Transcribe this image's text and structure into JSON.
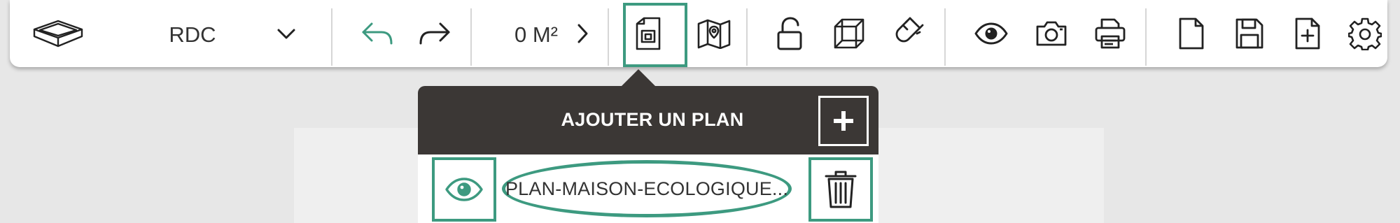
{
  "colors": {
    "accent": "#3d9a80",
    "popup_dark": "#3b3735",
    "toolbar_bg": "#ffffff",
    "workspace_bg": "#e7e7e7"
  },
  "toolbar": {
    "view_3d_icon": "box-3d-icon",
    "level": {
      "label": "RDC",
      "dropdown_icon": "chevron-down-icon"
    },
    "undo_icon": "undo-arrow-icon",
    "redo_icon": "redo-arrow-icon",
    "area": {
      "label": "0 M²",
      "expand_icon": "chevron-right-icon"
    },
    "plan_icon": "plan-document-icon",
    "map_icon": "folded-map-icon",
    "lock_icon": "unlocked-padlock-icon",
    "cube_icon": "wireframe-cube-icon",
    "magnet_icon": "magnet-icon",
    "view_icon": "eye-icon",
    "camera_icon": "camera-icon",
    "print_icon": "printer-icon",
    "new_icon": "blank-document-icon",
    "save_icon": "floppy-disk-icon",
    "add_file_icon": "document-plus-icon",
    "settings_icon": "gear-icon"
  },
  "popup": {
    "title": "AJOUTER UN PLAN",
    "add_icon": "plus-icon",
    "plan_item": {
      "name": "PLAN-MAISON-ECOLOGIQUE...",
      "visibility_icon": "eye-icon",
      "delete_icon": "trash-icon"
    }
  }
}
